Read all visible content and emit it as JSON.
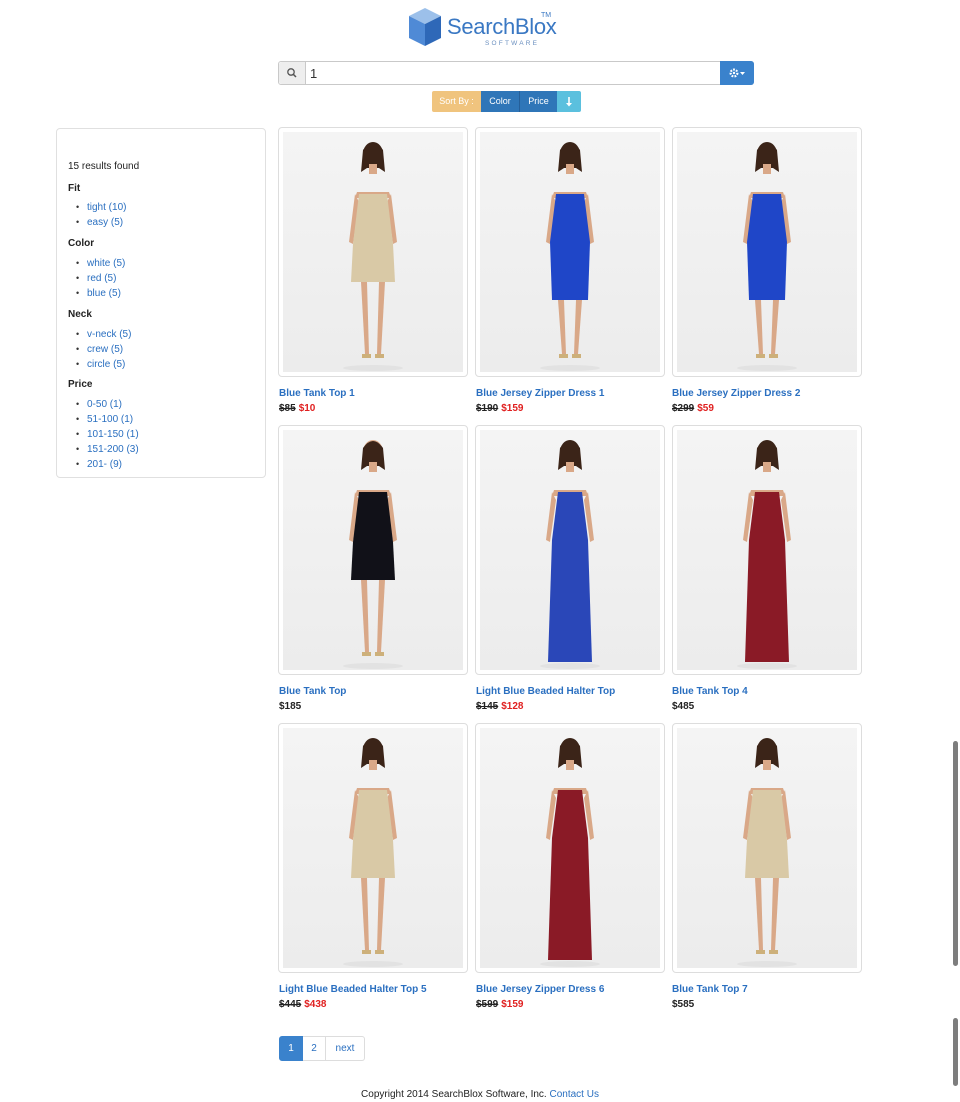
{
  "brand": {
    "name": "SearchBlox",
    "tm": "TM",
    "tagline": "SOFTWARE"
  },
  "search": {
    "value": "1",
    "icon": "search-icon",
    "settings_icon": "gear-icon"
  },
  "sort": {
    "label": "Sort By :",
    "options": [
      "Color",
      "Price"
    ],
    "direction_icon": "arrow-down-icon"
  },
  "sidebar": {
    "results": "15 results found",
    "facets": [
      {
        "title": "Fit",
        "items": [
          "tight (10)",
          "easy (5)"
        ]
      },
      {
        "title": "Color",
        "items": [
          "white (5)",
          "red (5)",
          "blue (5)"
        ]
      },
      {
        "title": "Neck",
        "items": [
          "v-neck (5)",
          "crew (5)",
          "circle (5)"
        ]
      },
      {
        "title": "Price",
        "items": [
          "0-50 (1)",
          "51-100 (1)",
          "101-150 (1)",
          "151-200 (3)",
          "201- (9)"
        ]
      }
    ]
  },
  "products": [
    {
      "title": "Blue Tank Top 1",
      "old_price": "$85",
      "price": "$10",
      "dress_color": "#d9c9a6",
      "length": "short",
      "view": "back"
    },
    {
      "title": "Blue Jersey Zipper Dress 1",
      "old_price": "$190",
      "price": "$159",
      "dress_color": "#1f46c8",
      "length": "midi",
      "view": "back"
    },
    {
      "title": "Blue Jersey Zipper Dress 2",
      "old_price": "$299",
      "price": "$59",
      "dress_color": "#1f46c8",
      "length": "midi",
      "view": "back"
    },
    {
      "title": "Blue Tank Top",
      "old_price": "",
      "price": "$185",
      "dress_color": "#111118",
      "length": "short",
      "view": "front"
    },
    {
      "title": "Light Blue Beaded Halter Top",
      "old_price": "$145",
      "price": "$128",
      "dress_color": "#2a47b8",
      "length": "long",
      "view": "back"
    },
    {
      "title": "Blue Tank Top 4",
      "old_price": "",
      "price": "$485",
      "dress_color": "#8a1a26",
      "length": "long",
      "view": "back"
    },
    {
      "title": "Light Blue Beaded Halter Top 5",
      "old_price": "$445",
      "price": "$438",
      "dress_color": "#d9c9a6",
      "length": "short",
      "view": "back"
    },
    {
      "title": "Blue Jersey Zipper Dress 6",
      "old_price": "$599",
      "price": "$159",
      "dress_color": "#8a1a26",
      "length": "long",
      "view": "back"
    },
    {
      "title": "Blue Tank Top 7",
      "old_price": "",
      "price": "$585",
      "dress_color": "#d9c9a6",
      "length": "short",
      "view": "back"
    }
  ],
  "pagination": {
    "pages": [
      "1",
      "2"
    ],
    "next": "next",
    "current": "1"
  },
  "footer": {
    "copyright": "Copyright 2014 SearchBlox Software, Inc.",
    "contact": "Contact Us"
  },
  "colors": {
    "link": "#2a6fc0",
    "primary": "#3a82cc",
    "sale": "#e02020",
    "sort_label": "#f0c47e",
    "sort_dir": "#5bc0de"
  }
}
